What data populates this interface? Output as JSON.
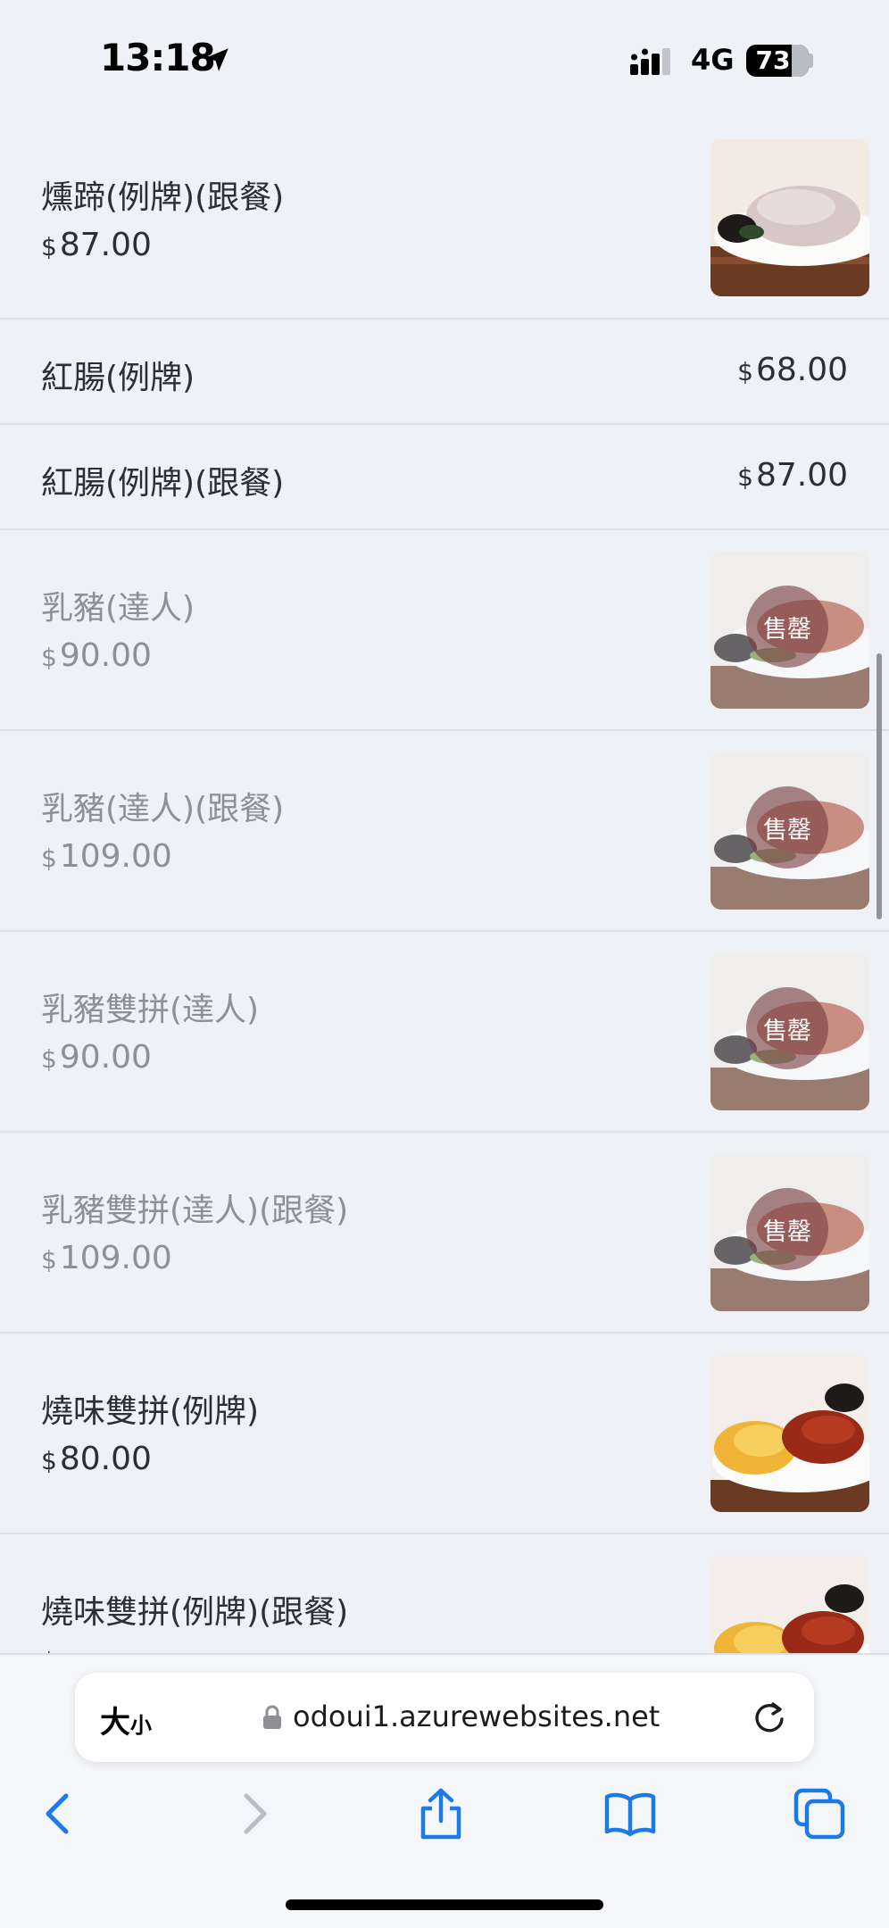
{
  "status_bar": {
    "time": "13:18",
    "network": "4G",
    "battery": "73",
    "battery_level": 0.73
  },
  "menu": {
    "currency": "$",
    "soldout_label": "售罄",
    "items": [
      {
        "name": "燻蹄(例牌)(跟餐)",
        "price": "87.00",
        "image": "pork-knuckle-dish",
        "sold_out": false
      },
      {
        "name": "紅腸(例牌)",
        "price": "68.00",
        "image": null,
        "sold_out": false
      },
      {
        "name": "紅腸(例牌)(跟餐)",
        "price": "87.00",
        "image": null,
        "sold_out": false
      },
      {
        "name": "乳豬(達人)",
        "price": "90.00",
        "image": "roast-pig-dish",
        "sold_out": true
      },
      {
        "name": "乳豬(達人)(跟餐)",
        "price": "109.00",
        "image": "roast-pig-dish",
        "sold_out": true
      },
      {
        "name": "乳豬雙拼(達人)",
        "price": "90.00",
        "image": "roast-pig-dish",
        "sold_out": true
      },
      {
        "name": "乳豬雙拼(達人)(跟餐)",
        "price": "109.00",
        "image": "roast-pig-dish",
        "sold_out": true
      },
      {
        "name": "燒味雙拼(例牌)",
        "price": "80.00",
        "image": "bbq-combo-dish",
        "sold_out": false
      },
      {
        "name": "燒味雙拼(例牌)(跟餐)",
        "price": "",
        "image": "bbq-combo-dish",
        "sold_out": false
      }
    ]
  },
  "browser": {
    "text_size_large": "大",
    "text_size_small": "小",
    "url": "odoui1.azurewebsites.net"
  }
}
